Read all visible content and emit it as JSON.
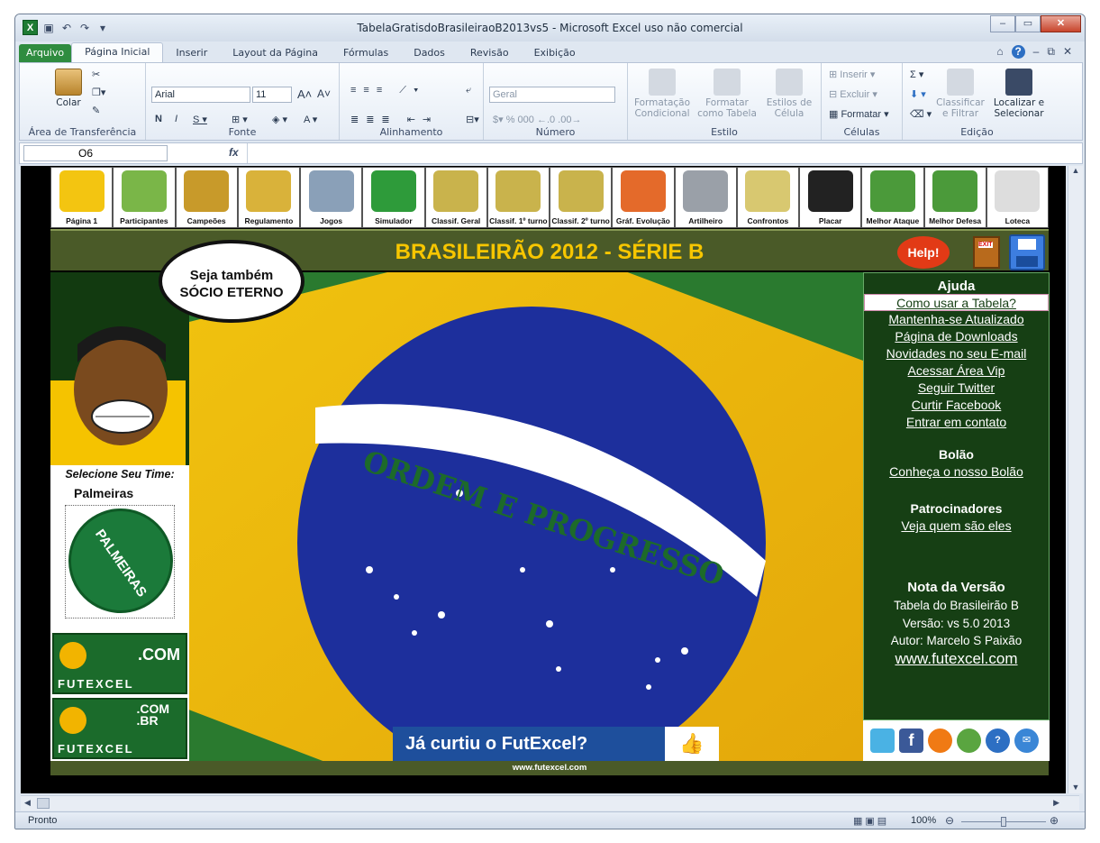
{
  "window": {
    "title": "TabelaGratisdoBrasileiraoB2013vs5  -  Microsoft Excel uso não comercial"
  },
  "ribbon": {
    "tabs": [
      "Arquivo",
      "Página Inicial",
      "Inserir",
      "Layout da Página",
      "Fórmulas",
      "Dados",
      "Revisão",
      "Exibição"
    ],
    "groups": {
      "clipboard": {
        "name": "Área de Transferência",
        "paste": "Colar"
      },
      "font": {
        "name": "Fonte",
        "family": "Arial",
        "size": "11"
      },
      "alignment": {
        "name": "Alinhamento"
      },
      "number": {
        "name": "Número",
        "format": "Geral"
      },
      "styles": {
        "name": "Estilo",
        "conditional": "Formatação Condicional",
        "as_table": "Formatar como Tabela",
        "cell_styles": "Estilos de Célula"
      },
      "cells": {
        "name": "Células",
        "insert": "Inserir",
        "delete": "Excluir",
        "format": "Formatar"
      },
      "editing": {
        "name": "Edição",
        "sort": "Classificar e Filtrar",
        "find": "Localizar e Selecionar"
      }
    }
  },
  "formula_bar": {
    "name_box": "O6",
    "fx": "fx",
    "value": ""
  },
  "nav_icons": [
    {
      "label": "Página 1"
    },
    {
      "label": "Participantes"
    },
    {
      "label": "Campeões"
    },
    {
      "label": "Regulamento"
    },
    {
      "label": "Jogos"
    },
    {
      "label": "Simulador"
    },
    {
      "label": "Classif. Geral"
    },
    {
      "label": "Classif. 1º turno"
    },
    {
      "label": "Classif. 2º turno"
    },
    {
      "label": "Gráf. Evolução"
    },
    {
      "label": "Artilheiro"
    },
    {
      "label": "Confrontos"
    },
    {
      "label": "Placar"
    },
    {
      "label": "Melhor Ataque"
    },
    {
      "label": "Melhor Defesa"
    },
    {
      "label": "Loteca"
    }
  ],
  "banner": {
    "title": "BRASILEIRÃO 2012 - SÉRIE B",
    "help": "Help!",
    "exit": "EXIT"
  },
  "left": {
    "speech": [
      "Seja também",
      "SÓCIO ETERNO"
    ],
    "select_team": "Selecione Seu Time:",
    "team": "Palmeiras",
    "logo_text": "PALMEIRAS",
    "futexcel_com": ".COM",
    "futexcel_combr": ".COM\n.BR",
    "futexcel_name": "FUTEXCEL"
  },
  "flag": {
    "motto": "ORDEM E PROGRESSO"
  },
  "like_banner": "Já curtiu o FutExcel?",
  "right": {
    "help_title": "Ajuda",
    "help_links": [
      "Como usar a Tabela?",
      "Mantenha-se Atualizado",
      "Página de Downloads",
      "Novidades no seu E-mail",
      "Acessar Área Vip",
      "Seguir Twitter",
      "Curtir Facebook",
      "Entrar em contato"
    ],
    "bolao_title": "Bolão",
    "bolao_link": "Conheça o nosso Bolão",
    "sponsors_title": "Patrocinadores",
    "sponsors_link": "Veja quem são eles",
    "version_title": "Nota da Versão",
    "version_lines": [
      "Tabela do Brasileirão B",
      "Versão:  vs 5.0  2013",
      "Autor: Marcelo S Paixão"
    ],
    "site": "www.futexcel.com"
  },
  "footer": {
    "url": "www.futexcel.com"
  },
  "status": {
    "text": "Pronto",
    "zoom": "100%"
  },
  "colors": {
    "excel_green": "#2f8c3f",
    "banner_green": "#4a5a28",
    "panel_green": "#163f14",
    "title_yellow": "#f7c600"
  }
}
